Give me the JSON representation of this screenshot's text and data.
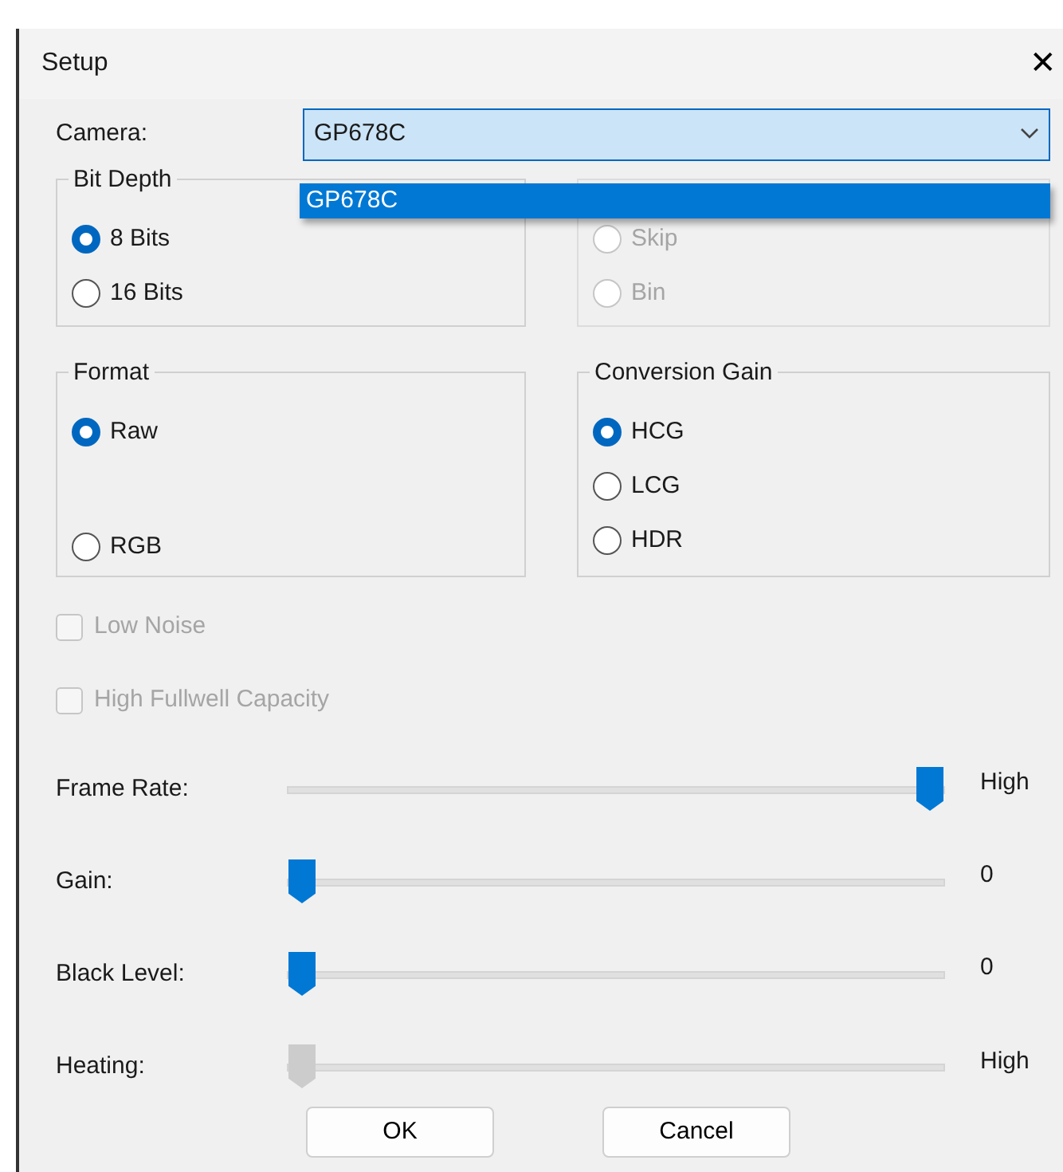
{
  "window": {
    "title": "Setup",
    "close": "✕"
  },
  "camera": {
    "label": "Camera:",
    "value": "GP678C",
    "expanded": true,
    "options": [
      {
        "label": "GP678C",
        "selected": true
      }
    ]
  },
  "groups": [
    {
      "title": "Bit Depth",
      "disabled": false,
      "options": [
        {
          "label": "8 Bits",
          "selected": true
        },
        {
          "label": "16 Bits",
          "selected": false
        }
      ]
    },
    {
      "disabled": true,
      "options": [
        {
          "label": "Skip",
          "selected": false
        },
        {
          "label": "Bin",
          "selected": false
        }
      ]
    },
    {
      "title": "Format",
      "disabled": false,
      "options": [
        {
          "label": "Raw",
          "selected": true
        },
        {
          "label": "RGB",
          "selected": false
        }
      ]
    },
    {
      "title": "Conversion Gain",
      "disabled": false,
      "options": [
        {
          "label": "HCG",
          "selected": true
        },
        {
          "label": "LCG",
          "selected": false
        },
        {
          "label": "HDR",
          "selected": false
        }
      ]
    }
  ],
  "checkboxes": [
    {
      "label": "Low Noise",
      "checked": false,
      "disabled": true
    },
    {
      "label": "High Fullwell Capacity",
      "checked": false,
      "disabled": true
    }
  ],
  "sliders": [
    {
      "label": "Frame Rate:",
      "level": 1,
      "reading": "High",
      "disabled": false
    },
    {
      "label": "Gain:",
      "level": 0,
      "reading": "0",
      "disabled": false
    },
    {
      "label": "Black Level:",
      "level": 0,
      "reading": "0",
      "disabled": false
    },
    {
      "label": "Heating:",
      "level": 0,
      "reading": "High",
      "disabled": true
    }
  ],
  "buttons": [
    "OK",
    "Cancel"
  ]
}
